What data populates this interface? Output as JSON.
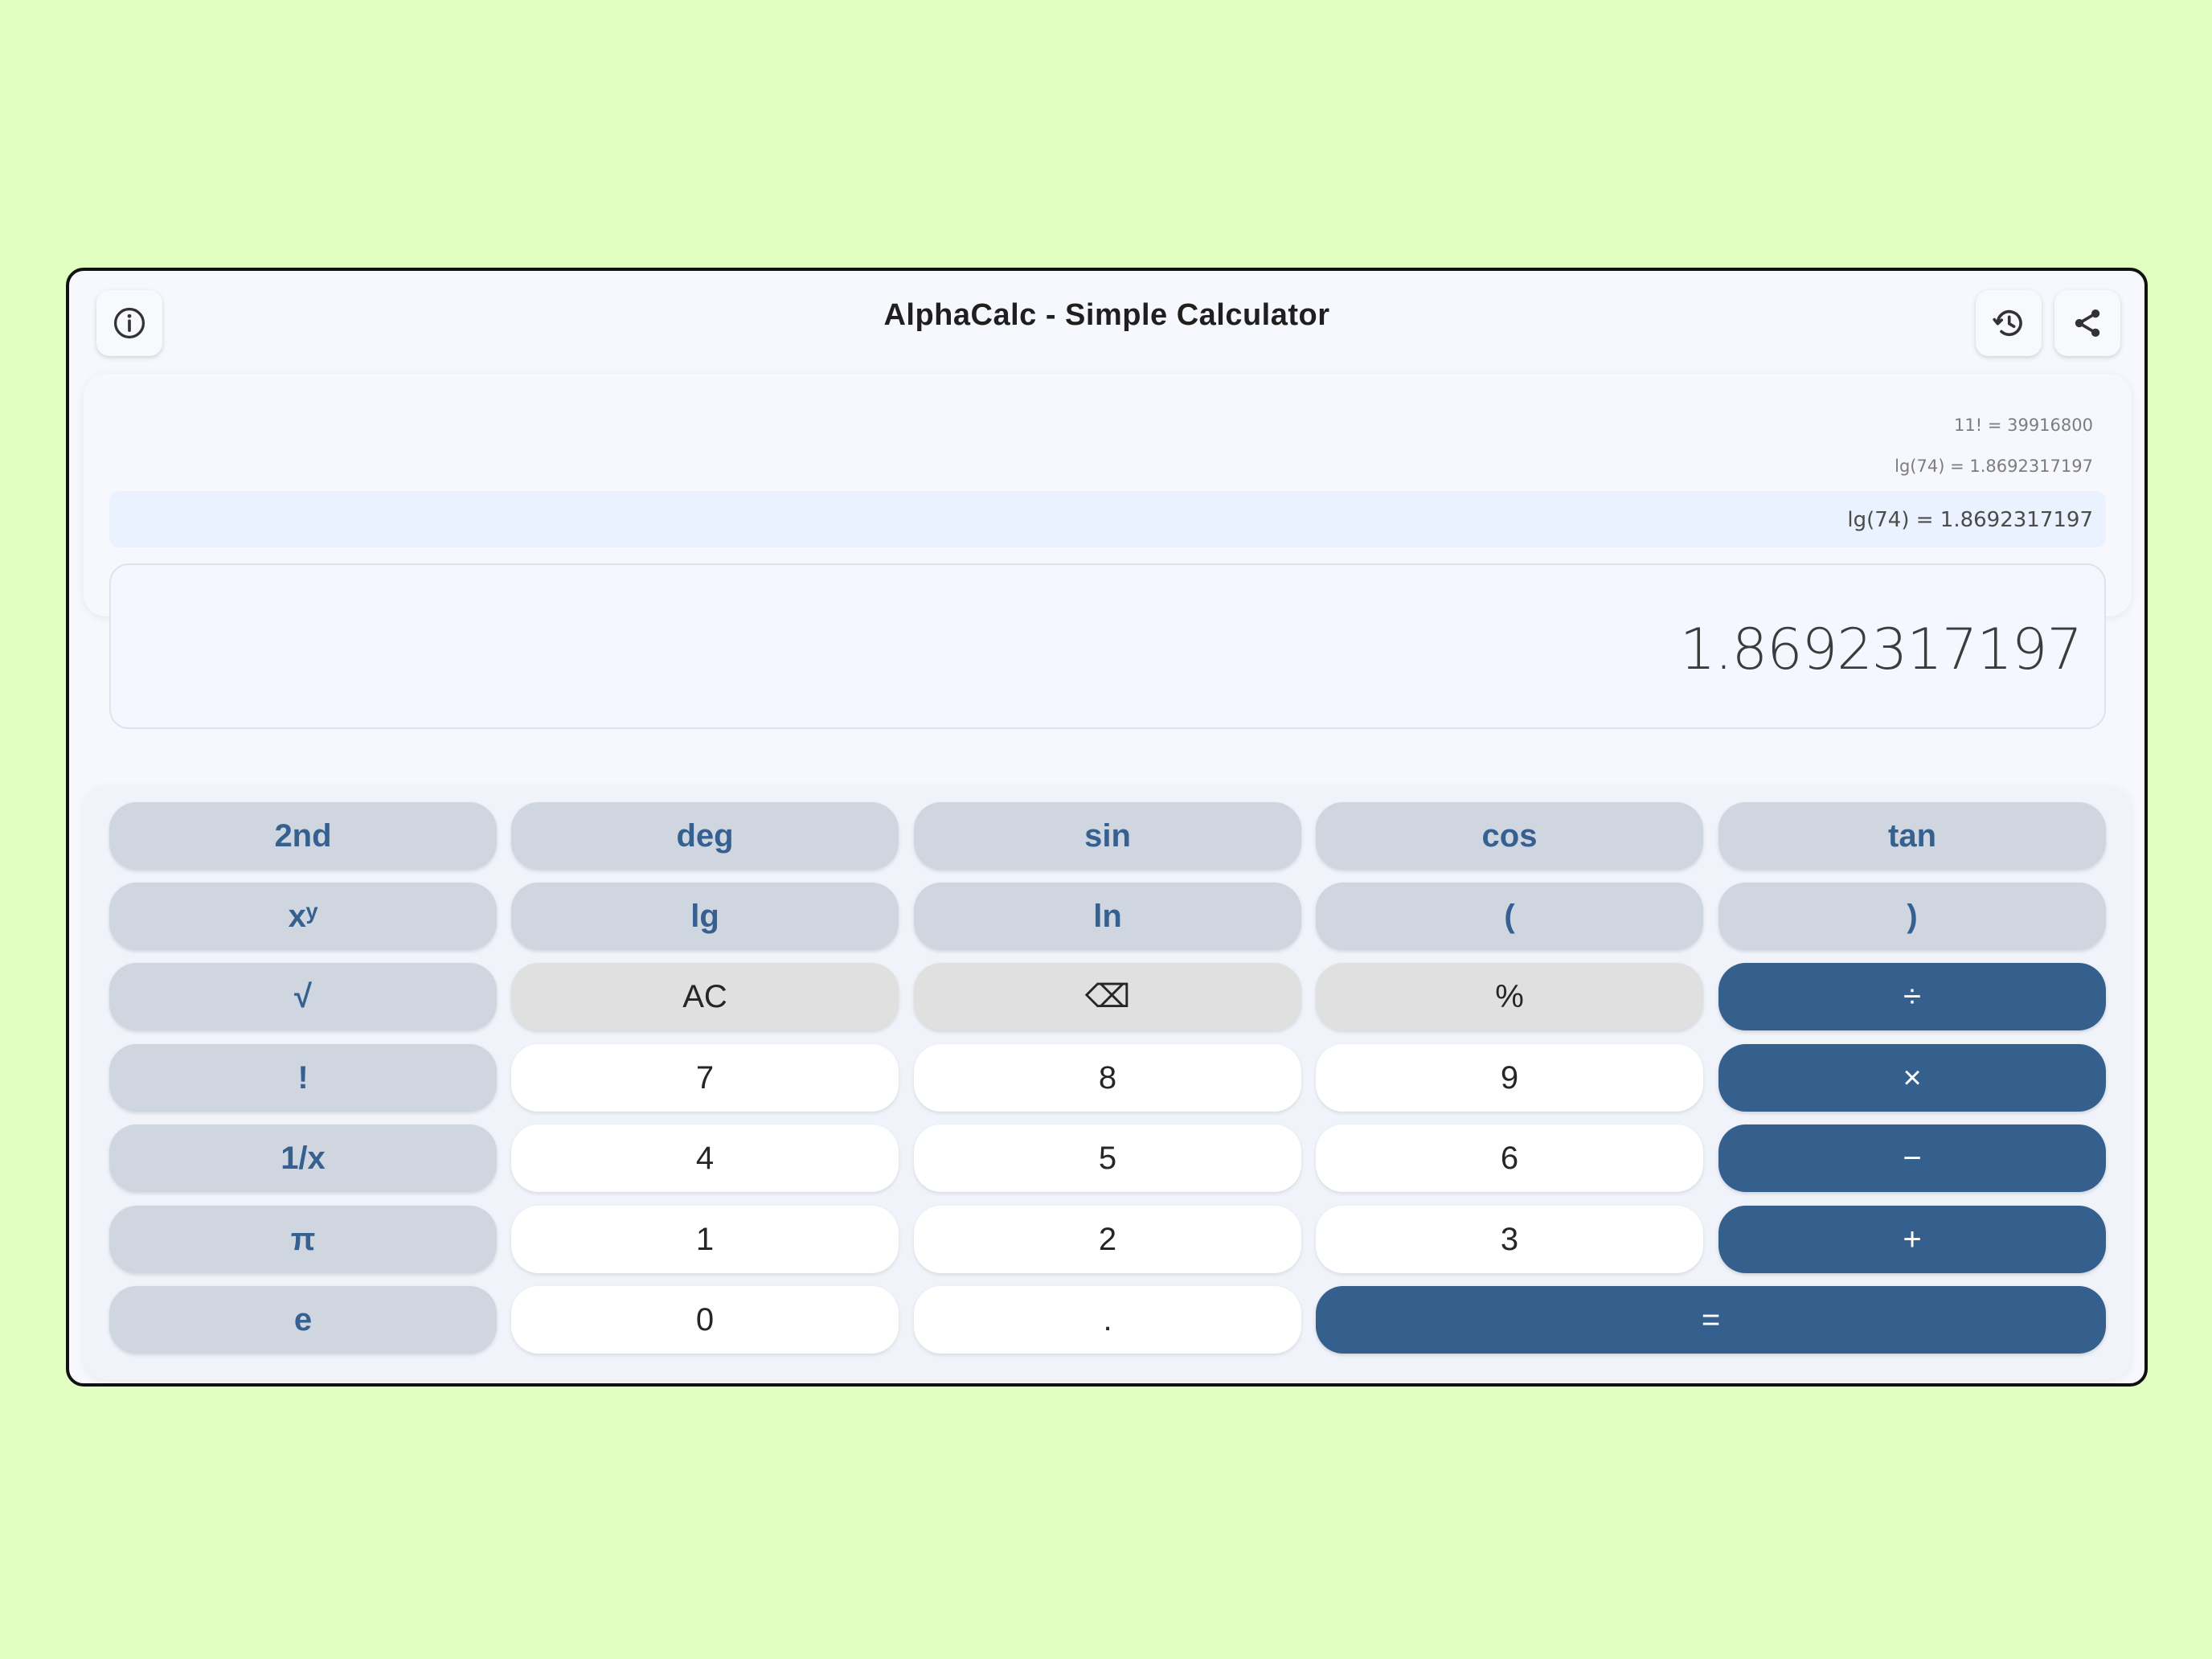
{
  "app": {
    "title": "AlphaCalc - Simple Calculator",
    "icons": {
      "info": "info-icon",
      "history": "history-icon",
      "share": "share-icon"
    }
  },
  "history": [
    "11! = 39916800",
    "lg(74) = 1.8692317197"
  ],
  "expression": "lg(74) = 1.8692317197",
  "result": "1.8692317197",
  "colors": {
    "page_background": "#e1ffc0",
    "function_key": "#cfd6df",
    "function_key_text": "#356090",
    "utility_key": "#e0e0e0",
    "number_key": "#ffffff",
    "operator_key": "#35608d"
  },
  "keys": {
    "row1": [
      "2nd",
      "deg",
      "sin",
      "cos",
      "tan"
    ],
    "row2": [
      "xʸ",
      "lg",
      "ln",
      "(",
      ")"
    ],
    "row3": [
      "√",
      "AC",
      "⌫",
      "%",
      "÷"
    ],
    "row4": [
      "!",
      "7",
      "8",
      "9",
      "×"
    ],
    "row5": [
      "1/x",
      "4",
      "5",
      "6",
      "−"
    ],
    "row6": [
      "π",
      "1",
      "2",
      "3",
      "+"
    ],
    "row7": [
      "e",
      "0",
      ".",
      "="
    ]
  }
}
